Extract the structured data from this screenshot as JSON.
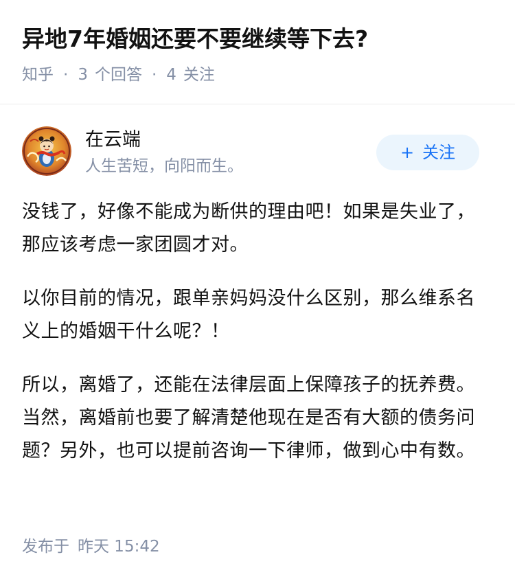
{
  "question": {
    "title": "异地7年婚姻还要不要继续等下去?",
    "source": "知乎",
    "answer_count": "3",
    "answer_label": "个回答",
    "follower_count": "4",
    "follower_label": "关注",
    "separator": "·"
  },
  "author": {
    "name": "在云端",
    "bio": "人生苦短，向阳而生。",
    "follow_plus": "+",
    "follow_label": "关注"
  },
  "answer": {
    "paragraphs": [
      "没钱了，好像不能成为断供的理由吧！如果是失业了，那应该考虑一家团圆才对。",
      "以你目前的情况，跟单亲妈妈没什么区别，那么维系名义上的婚姻干什么呢？！",
      "所以，离婚了，还能在法律层面上保障孩子的抚养费。当然，离婚前也要了解清楚他现在是否有大额的债务问题？另外，也可以提前咨询一下律师，做到心中有数。"
    ]
  },
  "footer": {
    "published_label": "发布于",
    "published_time": "昨天 15:42"
  },
  "colors": {
    "title": "#121212",
    "meta": "#8590a6",
    "accent": "#1772f6",
    "follow_bg": "#ebf5fd",
    "divider": "#ebebeb"
  },
  "icons": {
    "avatar": "avatar-illustration"
  }
}
